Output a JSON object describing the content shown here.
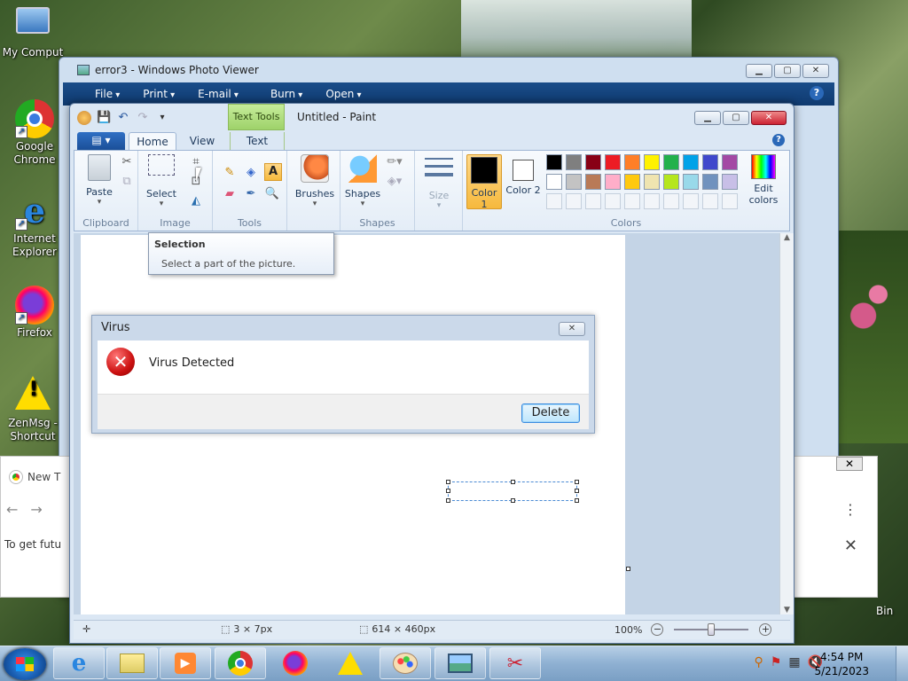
{
  "desktop": {
    "icons": [
      {
        "label": "My Comput"
      },
      {
        "label": "Google Chrome"
      },
      {
        "label": "Internet Explorer"
      },
      {
        "label": "Firefox"
      },
      {
        "label": "ZenMsg - Shortcut"
      }
    ],
    "bin_label": "Bin"
  },
  "photo_viewer": {
    "title": "error3 - Windows Photo Viewer",
    "menu": [
      "File",
      "Print",
      "E-mail",
      "Burn",
      "Open"
    ]
  },
  "chrome": {
    "tab_label": "New T",
    "body_text": "To get futu"
  },
  "paint": {
    "title": "Untitled - Paint",
    "context_tab": "Text Tools",
    "file_menu_icon": "paint-menu-icon",
    "tabs": {
      "home": "Home",
      "view": "View",
      "text": "Text"
    },
    "groups": {
      "clipboard": {
        "label": "Clipboard",
        "paste": "Paste"
      },
      "image": {
        "label": "Image",
        "select": "Select"
      },
      "tools": {
        "label": "Tools"
      },
      "brushes": {
        "label": "Brushes"
      },
      "shapes": {
        "label": "Shapes",
        "shapes_btn": "Shapes"
      },
      "size": {
        "label": "Size"
      },
      "colors": {
        "label": "Colors",
        "color1": "Color 1",
        "color2": "Color 2",
        "edit_colors": "Edit colors",
        "color1_value": "#000000",
        "color2_value": "#ffffff",
        "palette_row1": [
          "#000000",
          "#7f7f7f",
          "#880015",
          "#ed1c24",
          "#ff7f27",
          "#fff200",
          "#22b14c",
          "#00a2e8",
          "#3f48cc",
          "#a349a4"
        ],
        "palette_row2": [
          "#ffffff",
          "#c3c3c3",
          "#b97a57",
          "#ffaec9",
          "#ffc90e",
          "#efe4b0",
          "#b5e61d",
          "#99d9ea",
          "#7092be",
          "#c8bfe7"
        ]
      }
    },
    "tooltip": {
      "title": "Selection",
      "body": "Select a part of the picture."
    },
    "status": {
      "selection_size": "3 × 7px",
      "canvas_size": "614 × 460px",
      "zoom": "100%"
    }
  },
  "virus_dialog": {
    "title": "Virus",
    "message": "Virus Detected",
    "button": "Delete"
  },
  "taskbar": {
    "time": "4:54 PM",
    "date": "5/21/2023"
  }
}
